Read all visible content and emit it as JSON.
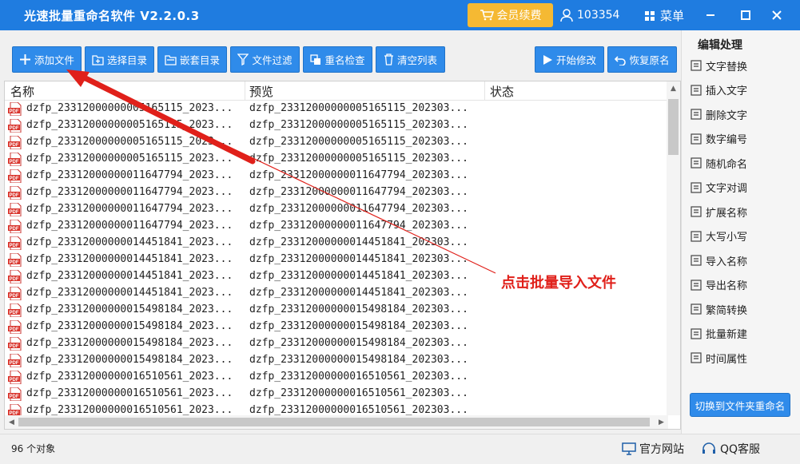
{
  "window": {
    "title": "光速批量重命名软件 V2.2.0.3",
    "vip_label": "会员续费",
    "user_id": "103354",
    "menu_label": "菜单"
  },
  "toolbar": {
    "add_file": "添加文件",
    "select_dir": "选择目录",
    "nested_dir": "嵌套目录",
    "file_filter": "文件过滤",
    "rename_check": "重名检查",
    "clear_list": "清空列表",
    "start_modify": "开始修改",
    "restore_name": "恢复原名"
  },
  "list": {
    "headers": {
      "name": "名称",
      "preview": "预览",
      "status": "状态"
    },
    "rows": [
      {
        "name": "dzfp_23312000000005165115_2023...",
        "preview": "dzfp_23312000000005165115_202303..."
      },
      {
        "name": "dzfp_23312000000005165115_2023...",
        "preview": "dzfp_23312000000005165115_202303..."
      },
      {
        "name": "dzfp_23312000000005165115_2023...",
        "preview": "dzfp_23312000000005165115_202303..."
      },
      {
        "name": "dzfp_23312000000005165115_2023...",
        "preview": "dzfp_23312000000005165115_202303..."
      },
      {
        "name": "dzfp_23312000000011647794_2023...",
        "preview": "dzfp_23312000000011647794_202303..."
      },
      {
        "name": "dzfp_23312000000011647794_2023...",
        "preview": "dzfp_23312000000011647794_202303..."
      },
      {
        "name": "dzfp_23312000000011647794_2023...",
        "preview": "dzfp_23312000000011647794_202303..."
      },
      {
        "name": "dzfp_23312000000011647794_2023...",
        "preview": "dzfp_23312000000011647794_202303..."
      },
      {
        "name": "dzfp_23312000000014451841_2023...",
        "preview": "dzfp_23312000000014451841_202303..."
      },
      {
        "name": "dzfp_23312000000014451841_2023...",
        "preview": "dzfp_23312000000014451841_202303..."
      },
      {
        "name": "dzfp_23312000000014451841_2023...",
        "preview": "dzfp_23312000000014451841_202303..."
      },
      {
        "name": "dzfp_23312000000014451841_2023...",
        "preview": "dzfp_23312000000014451841_202303..."
      },
      {
        "name": "dzfp_23312000000015498184_2023...",
        "preview": "dzfp_23312000000015498184_202303..."
      },
      {
        "name": "dzfp_23312000000015498184_2023...",
        "preview": "dzfp_23312000000015498184_202303..."
      },
      {
        "name": "dzfp_23312000000015498184_2023...",
        "preview": "dzfp_23312000000015498184_202303..."
      },
      {
        "name": "dzfp_23312000000015498184_2023...",
        "preview": "dzfp_23312000000015498184_202303..."
      },
      {
        "name": "dzfp_23312000000016510561_2023...",
        "preview": "dzfp_23312000000016510561_202303..."
      },
      {
        "name": "dzfp_23312000000016510561_2023...",
        "preview": "dzfp_23312000000016510561_202303..."
      },
      {
        "name": "dzfp_23312000000016510561_2023...",
        "preview": "dzfp_23312000000016510561_202303..."
      }
    ]
  },
  "sidebar": {
    "title": "编辑处理",
    "items": [
      "文字替换",
      "插入文字",
      "删除文字",
      "数字编号",
      "随机命名",
      "文字对调",
      "扩展名称",
      "大写小写",
      "导入名称",
      "导出名称",
      "繁简转换",
      "批量新建",
      "时间属性"
    ],
    "switch_label": "切换到文件夹重命名"
  },
  "status": {
    "count": "96 个对象",
    "website": "官方网站",
    "qq_service": "QQ客服"
  },
  "annotation": {
    "text": "点击批量导入文件",
    "color": "#e0201a"
  },
  "colors": {
    "titlebar": "#1f7ce0",
    "button": "#2f8bea",
    "vip": "#f5b933"
  }
}
